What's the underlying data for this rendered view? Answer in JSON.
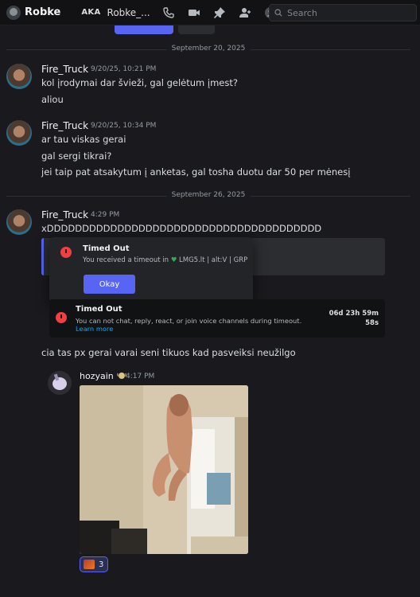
{
  "header": {
    "title": "Robke",
    "aka_label": "AKA",
    "aka_value": "Robke_...",
    "search_placeholder": "Search"
  },
  "dividers": [
    "September 20, 2025",
    "September 26, 2025"
  ],
  "messages": [
    {
      "author": "Fire_Truck",
      "time": "9/20/25, 10:21 PM",
      "lines": [
        "kol įrodymai dar švieži, gal gelėtum įmest?",
        "aliou"
      ]
    },
    {
      "author": "Fire_Truck",
      "time": "9/20/25, 10:34 PM",
      "lines": [
        "ar tau viskas gerai",
        "gal sergi tikrai?",
        "jei taip pat atsakytum į anketas, gal tosha duotu dar 50 per mėnesį"
      ]
    },
    {
      "author": "Fire_Truck",
      "time": "4:29 PM",
      "lines": [
        "xDDDDDDDDDDDDDDDDDDDDDDDDDDDDDDDDDDDDDDD",
        "cia tas px gerai varai seni tikuos kad pasveiksi neužilgo"
      ]
    }
  ],
  "timeout_modal": {
    "title": "Timed Out",
    "text_prefix": "You received a timeout in",
    "server": "LMG5.lt | alt:V | GRP",
    "ok_label": "Okay"
  },
  "timeout_notice": {
    "title": "Timed Out",
    "text": "You can not chat, reply, react, or join voice channels during timeout.",
    "link": "Learn more",
    "remaining_1": "06d 23h 59m",
    "remaining_2": "58s"
  },
  "reply": {
    "author": "hozyain",
    "time": "4:17 PM"
  },
  "reaction": {
    "count": "3"
  }
}
